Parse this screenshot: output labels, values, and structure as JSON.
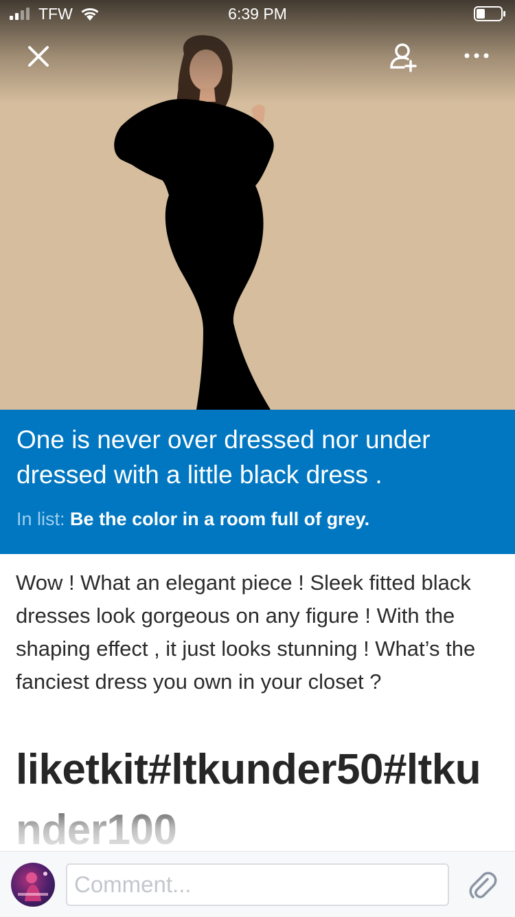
{
  "status_bar": {
    "carrier": "TFW",
    "time": "6:39 PM",
    "icons": [
      "signal-icon",
      "wifi-icon",
      "battery-icon"
    ]
  },
  "top_bar": {
    "icons": [
      "close-icon",
      "add-person-icon",
      "more-icon"
    ]
  },
  "post": {
    "title": "One is never over dressed nor under dressed with a little black dress .",
    "list_prefix": "In list:",
    "list_name": "Be the color in a room full of grey.",
    "description": "Wow ! What an elegant piece ! Sleek fitted black dresses look gorgeous on any figure ! With the shaping effect , it just looks stunning ! What’s the fanciest dress you own in your closet ?",
    "hashtags": "liketkit#ltkunder50#ltkunder100"
  },
  "comment_bar": {
    "placeholder": "Comment...",
    "icons": [
      "avatar",
      "paperclip-icon"
    ]
  },
  "colors": {
    "accent_blue": "#0177c1",
    "hero_background": "#d5bd9d",
    "comment_bar_background": "#f7f8fa"
  }
}
